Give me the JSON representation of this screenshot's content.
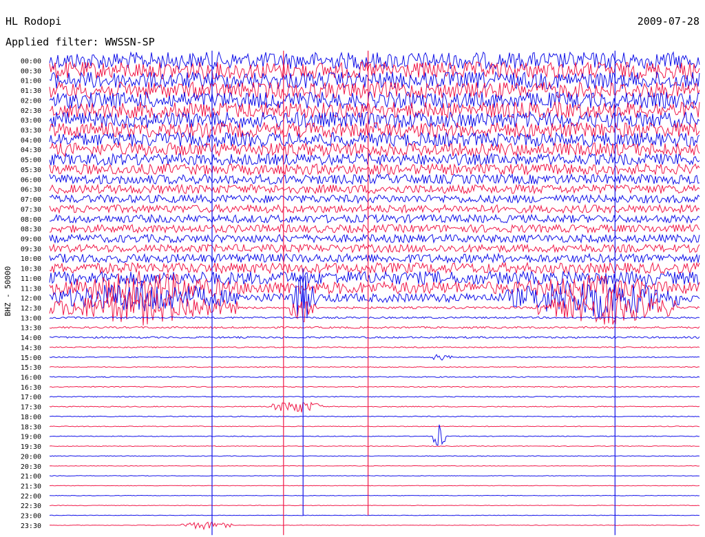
{
  "header": {
    "station": "HL Rodopi",
    "date": "2009-07-28",
    "filter_label": "Applied filter: WWSSN-SP"
  },
  "channel_label": "BHZ - 50000",
  "colors": {
    "trace_a": "#1010e8",
    "trace_b": "#f01848",
    "background": "#ffffff",
    "text": "#000000"
  },
  "chart_data": {
    "type": "line",
    "description_kind": "helicorder",
    "rows": [
      {
        "time": "00:00",
        "amplitude": 0.95
      },
      {
        "time": "00:30",
        "amplitude": 0.95
      },
      {
        "time": "01:00",
        "amplitude": 0.95
      },
      {
        "time": "01:30",
        "amplitude": 0.92
      },
      {
        "time": "02:00",
        "amplitude": 0.92
      },
      {
        "time": "02:30",
        "amplitude": 0.9
      },
      {
        "time": "03:00",
        "amplitude": 0.9
      },
      {
        "time": "03:30",
        "amplitude": 0.85
      },
      {
        "time": "04:00",
        "amplitude": 0.8
      },
      {
        "time": "04:30",
        "amplitude": 0.75
      },
      {
        "time": "05:00",
        "amplitude": 0.65
      },
      {
        "time": "05:30",
        "amplitude": 0.6
      },
      {
        "time": "06:00",
        "amplitude": 0.55
      },
      {
        "time": "06:30",
        "amplitude": 0.5
      },
      {
        "time": "07:00",
        "amplitude": 0.45
      },
      {
        "time": "07:30",
        "amplitude": 0.45
      },
      {
        "time": "08:00",
        "amplitude": 0.45
      },
      {
        "time": "08:30",
        "amplitude": 0.45
      },
      {
        "time": "09:00",
        "amplitude": 0.45
      },
      {
        "time": "09:30",
        "amplitude": 0.45
      },
      {
        "time": "10:00",
        "amplitude": 0.5
      },
      {
        "time": "10:30",
        "amplitude": 0.6
      },
      {
        "time": "11:00",
        "amplitude": 0.75
      },
      {
        "time": "11:30",
        "amplitude": 0.7
      },
      {
        "time": "12:00",
        "amplitude": 0.5
      },
      {
        "time": "12:30",
        "amplitude": 0.12
      },
      {
        "time": "13:00",
        "amplitude": 0.1
      },
      {
        "time": "13:30",
        "amplitude": 0.1
      },
      {
        "time": "14:00",
        "amplitude": 0.1
      },
      {
        "time": "14:30",
        "amplitude": 0.06
      },
      {
        "time": "15:00",
        "amplitude": 0.06
      },
      {
        "time": "15:30",
        "amplitude": 0.05
      },
      {
        "time": "16:00",
        "amplitude": 0.06
      },
      {
        "time": "16:30",
        "amplitude": 0.05
      },
      {
        "time": "17:00",
        "amplitude": 0.05
      },
      {
        "time": "17:30",
        "amplitude": 0.05
      },
      {
        "time": "18:00",
        "amplitude": 0.05
      },
      {
        "time": "18:30",
        "amplitude": 0.04
      },
      {
        "time": "19:00",
        "amplitude": 0.04
      },
      {
        "time": "19:30",
        "amplitude": 0.04
      },
      {
        "time": "20:00",
        "amplitude": 0.04
      },
      {
        "time": "20:30",
        "amplitude": 0.03
      },
      {
        "time": "21:00",
        "amplitude": 0.03
      },
      {
        "time": "21:30",
        "amplitude": 0.03
      },
      {
        "time": "22:00",
        "amplitude": 0.03
      },
      {
        "time": "22:30",
        "amplitude": 0.03
      },
      {
        "time": "23:00",
        "amplitude": 0.03
      },
      {
        "time": "23:30",
        "amplitude": 0.03
      }
    ],
    "events": [
      {
        "row": "11:30",
        "start": 0.0,
        "end": 0.29,
        "amplitude": 2.0
      },
      {
        "row": "12:00",
        "start": 0.0,
        "end": 0.29,
        "amplitude": 2.0
      },
      {
        "row": "12:30",
        "start": 0.0,
        "end": 0.29,
        "amplitude": 2.0
      },
      {
        "row": "12:00",
        "start": 0.37,
        "end": 0.41,
        "amplitude": 3.0
      },
      {
        "row": "12:30",
        "start": 0.37,
        "end": 0.41,
        "amplitude": 2.0
      },
      {
        "row": "11:30",
        "start": 0.7,
        "end": 0.97,
        "amplitude": 1.5
      },
      {
        "row": "12:00",
        "start": 0.7,
        "end": 0.97,
        "amplitude": 2.5
      },
      {
        "row": "12:30",
        "start": 0.75,
        "end": 0.97,
        "amplitude": 2.0
      },
      {
        "row": "15:00",
        "start": 0.58,
        "end": 0.62,
        "amplitude": 0.4
      },
      {
        "row": "17:30",
        "start": 0.34,
        "end": 0.42,
        "amplitude": 0.8
      },
      {
        "row": "19:00",
        "start": 0.59,
        "end": 0.61,
        "amplitude": 1.5
      },
      {
        "row": "23:30",
        "start": 0.2,
        "end": 0.28,
        "amplitude": 0.5
      }
    ],
    "spikes": [
      {
        "time_fraction": 0.25,
        "from_row": "00:00",
        "to_row": "23:30"
      },
      {
        "time_fraction": 0.36,
        "from_row": "00:00",
        "to_row": "23:30"
      },
      {
        "time_fraction": 0.39,
        "from_row": "11:00",
        "to_row": "22:30"
      },
      {
        "time_fraction": 0.49,
        "from_row": "00:00",
        "to_row": "22:30"
      },
      {
        "time_fraction": 0.87,
        "from_row": "00:00",
        "to_row": "23:30"
      }
    ]
  }
}
